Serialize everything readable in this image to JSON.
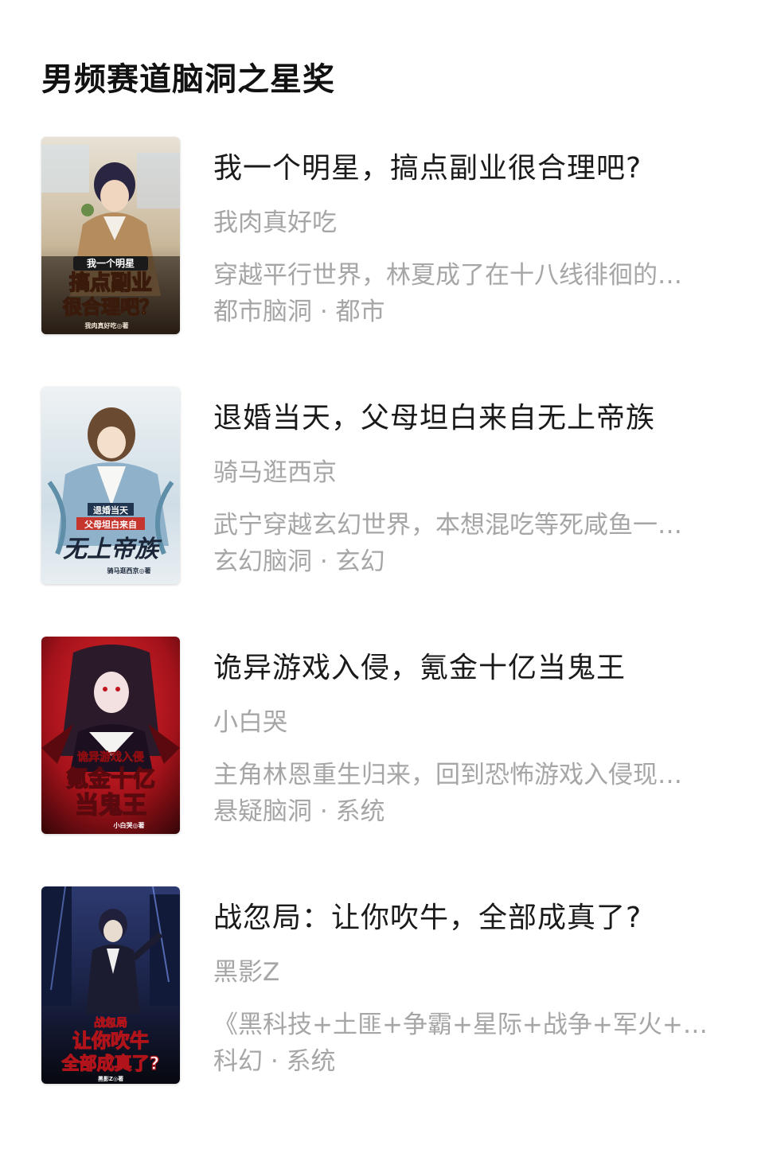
{
  "section": {
    "title": "男频赛道脑洞之星奖"
  },
  "books": [
    {
      "title": "我一个明星，搞点副业很合理吧?",
      "author": "我肉真好吃",
      "description": "穿越平行世界，林夏成了在十八线徘徊的…",
      "tags": "都市脑洞 · 都市",
      "cover": {
        "line1": "我一个明星",
        "line2": "搞点副业",
        "line3": "很合理吧？",
        "author": "我肉真好吃◎著",
        "palette": [
          "#c9b79a",
          "#7a5a3a",
          "#f2d46a",
          "#e0332b"
        ]
      }
    },
    {
      "title": "退婚当天，父母坦白来自无上帝族",
      "author": "骑马逛西京",
      "description": "武宁穿越玄幻世界，本想混吃等死咸鱼一…",
      "tags": "玄幻脑洞 · 玄幻",
      "cover": {
        "line1": "退婚当天",
        "line2": "父母坦白来自",
        "line3": "无上帝族",
        "author": "骑马逛西京◎著",
        "palette": [
          "#dfe8ee",
          "#8fb1c9",
          "#1f3550",
          "#c7362e"
        ]
      }
    },
    {
      "title": "诡异游戏入侵，氪金十亿当鬼王",
      "author": "小白哭",
      "description": "主角林恩重生归来，回到恐怖游戏入侵现…",
      "tags": "悬疑脑洞 · 系统",
      "cover": {
        "line1": "诡异游戏入侵",
        "line2": "氪金十亿",
        "line3": "当鬼王",
        "author": "小白哭◎著",
        "palette": [
          "#8f0f12",
          "#d11a1f",
          "#2a1a2a",
          "#ffffff"
        ]
      }
    },
    {
      "title": "战忽局：让你吹牛，全部成真了?",
      "author": "黑影Z",
      "description": "《黑科技+土匪+争霸+星际+战争+军火+…",
      "tags": "科幻 · 系统",
      "cover": {
        "line1": "战忽局",
        "line2": "让你吹牛",
        "line3": "全部成真了?",
        "author": "黑影Z◎著",
        "palette": [
          "#1b2348",
          "#3a4a86",
          "#0e1020",
          "#ffffff"
        ]
      }
    }
  ]
}
